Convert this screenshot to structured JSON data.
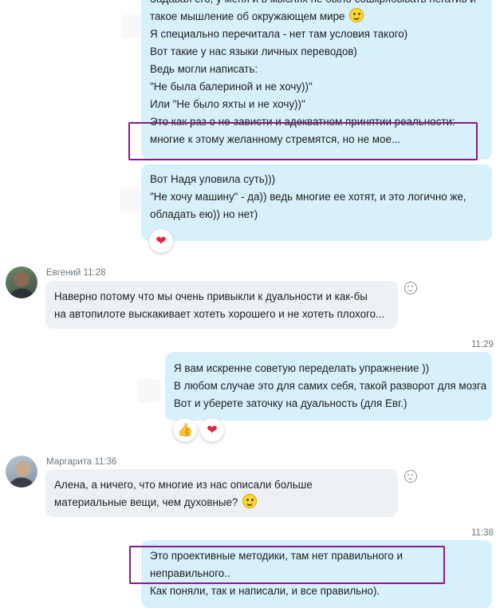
{
  "messages": [
    {
      "id": "m1",
      "direction": "out",
      "lines": [
        "Задавая его, у меня и в мыслях не было сошкрябывать негатив и",
        "такое мышление об окружающем мире",
        "Я специально перечитала - нет там условия такого)",
        "Вот такие у нас языки личных переводов)",
        "Ведь могли написать:",
        "\"Не была балериной и не хочу))\"",
        "Или \"Не было яхты и не хочу))\"",
        "Это как раз о не-зависти и адекватном принятии реальности:",
        "многие к этому желанному стремятся, но не мое..."
      ],
      "emoji_after_line": 1,
      "emoji": "smiley"
    },
    {
      "id": "m2",
      "direction": "out",
      "lines": [
        "Вот Надя уловила суть)))",
        "\"Не хочу машину\" - да)) ведь многие ее хотят, и это логично же,",
        "обладать ею)) но нет)"
      ],
      "reactions": [
        "heart"
      ]
    },
    {
      "id": "m3",
      "direction": "in",
      "sender": "Евгений",
      "time": "11:28",
      "lines": [
        "Наверно потому что мы очень привыкли к дуальности и как-бы",
        "на автопилоте выскакивает хотеть хорошего и не хотеть плохого..."
      ]
    },
    {
      "id": "m4",
      "direction": "out",
      "time": "11:29",
      "lines": [
        "Я вам искренне советую переделать упражнение ))",
        "В любом случае это для самих себя, такой разворот для мозга",
        "Вот и уберете заточку на дуальность (для Евг.)"
      ],
      "reactions": [
        "thumbs-up",
        "heart"
      ]
    },
    {
      "id": "m5",
      "direction": "in",
      "sender": "Маргарита",
      "time": "11:36",
      "lines": [
        "Алена, а ничего, что многие из нас описали больше",
        "материальные вещи, чем духовные?"
      ],
      "emoji_after_line": 1,
      "emoji": "smiley"
    },
    {
      "id": "m6",
      "direction": "out",
      "time": "11:38",
      "lines": [
        "Это проективные методики, там нет правильного и",
        "неправильного..",
        "Как поняли, так и написали, и все правильно)."
      ]
    }
  ],
  "colors": {
    "outgoing_bubble": "#d6f0fc",
    "incoming_bubble": "#eef1f4",
    "highlight_box": "#8a1a8a",
    "heart": "#e0293f"
  },
  "icons": {
    "heart": "heart-icon",
    "thumbs_up": "thumbs-up-icon",
    "smiley": "smiley-emoji-icon",
    "add_reaction": "add-reaction-icon"
  }
}
